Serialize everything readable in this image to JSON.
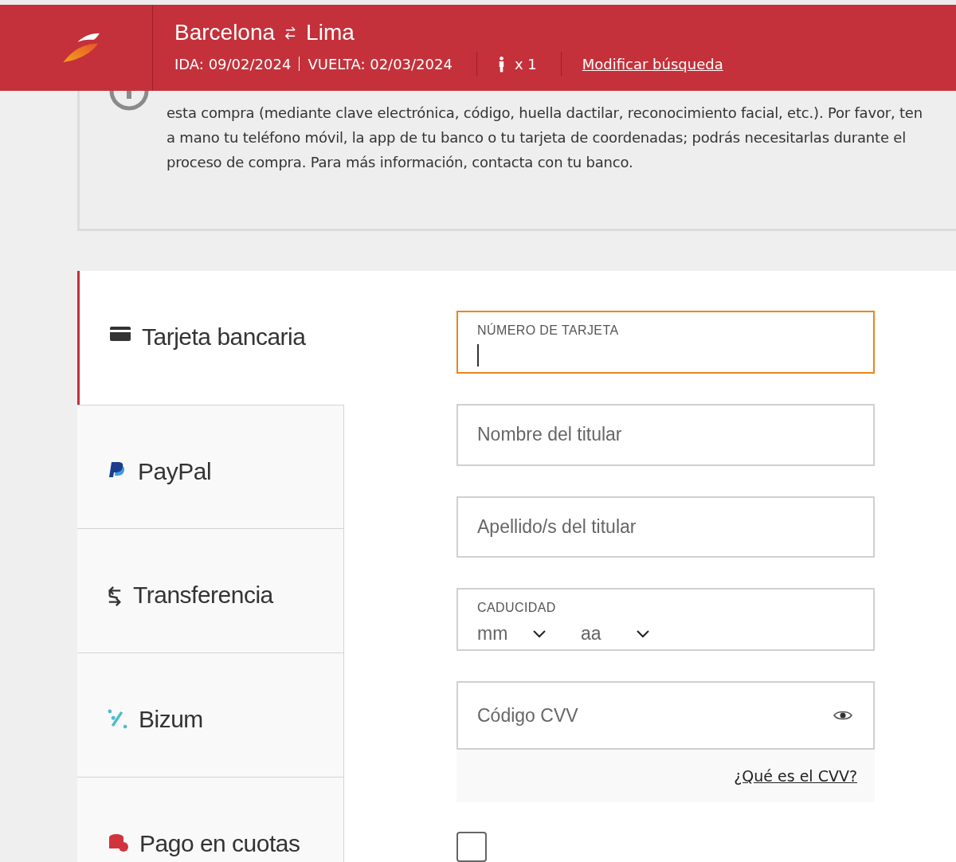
{
  "header": {
    "origin": "Barcelona",
    "destination": "Lima",
    "outbound": "IDA: 09/02/2024",
    "return": "VUELTA: 02/03/2024",
    "passengers": "x 1",
    "modify_link": "Modificar búsqueda"
  },
  "notice": {
    "text": "esta compra (mediante clave electrónica, código, huella dactilar, reconocimiento facial, etc.). Por favor, ten a mano tu teléfono móvil, la app de tu banco o tu tarjeta de coordenadas; podrás necesitarlas durante el proceso de compra. Para más información, contacta con tu banco."
  },
  "payment_methods": [
    {
      "kind": "card",
      "label": "Tarjeta bancaria",
      "selected": true
    },
    {
      "kind": "paypal",
      "label": "PayPal",
      "selected": false
    },
    {
      "kind": "transfer",
      "label": "Transferencia",
      "selected": false
    },
    {
      "kind": "bizum",
      "label": "Bizum",
      "selected": false
    },
    {
      "kind": "installments",
      "label": "Pago en cuotas",
      "selected": false
    }
  ],
  "form": {
    "card_number": {
      "label": "NÚMERO DE TARJETA",
      "focused": true
    },
    "holder_name": {
      "placeholder": "Nombre del titular",
      "focused": false
    },
    "holder_surname": {
      "placeholder": "Apellido/s del titular",
      "focused": false
    },
    "expiry": {
      "label": "CADUCIDAD",
      "month_placeholder": "mm",
      "year_placeholder": "aa"
    },
    "cvv": {
      "placeholder": "Código CVV",
      "focused": false
    },
    "cvv_help": "¿Qué es el CVV?",
    "checkbox": {
      "checked": false
    }
  }
}
